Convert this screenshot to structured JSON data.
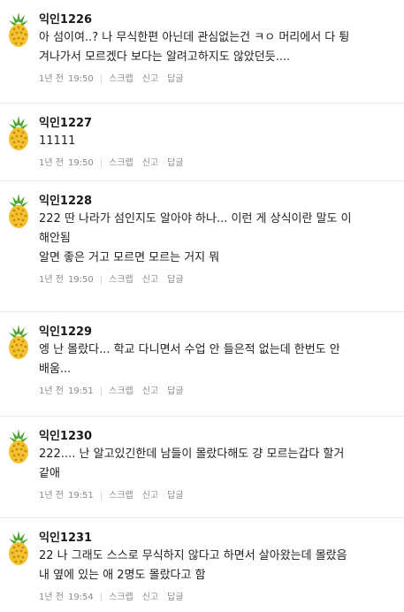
{
  "comments": [
    {
      "nick": "익인1226",
      "lines": [
        "아 섬이여..? 나 무식한편 아닌데 관심없는건 ㅋㅇ 머리에서 다 튕",
        "겨나가서 모르겠다 보다는 알려고하지도 않았던듯...."
      ],
      "date": "1년 전",
      "time": "19:50",
      "actions": {
        "scrap": "스크랩",
        "report": "신고",
        "reply": "답글"
      }
    },
    {
      "nick": "익인1227",
      "lines": [
        "11111"
      ],
      "date": "1년 전",
      "time": "19:50",
      "actions": {
        "scrap": "스크랩",
        "report": "신고",
        "reply": "답글"
      }
    },
    {
      "nick": "익인1228",
      "lines": [
        "222 딴 나라가 섬인지도 알아야 하나... 이런 게 상식이란 말도 이",
        "해안됨",
        "알면 좋은 거고 모르면 모르는 거지 뭐"
      ],
      "date": "1년 전",
      "time": "19:50",
      "actions": {
        "scrap": "스크랩",
        "report": "신고",
        "reply": "답글"
      }
    },
    {
      "nick": "익인1229",
      "lines": [
        "엥 난 몰랐다... 학교 다니면서 수업 안 들은적 없는데 한번도 안",
        "배움..."
      ],
      "date": "1년 전",
      "time": "19:51",
      "actions": {
        "scrap": "스크랩",
        "report": "신고",
        "reply": "답글"
      }
    },
    {
      "nick": "익인1230",
      "lines": [
        "222.... 난 알고있긴한데 남들이 몰랐다해도 걍 모르는갑다 할거",
        "같애"
      ],
      "date": "1년 전",
      "time": "19:51",
      "actions": {
        "scrap": "스크랩",
        "report": "신고",
        "reply": "답글"
      }
    },
    {
      "nick": "익인1231",
      "lines": [
        "22 나 그래도 스스로 무식하지 않다고 하면서 살아왔는데 몰랐음",
        "내 옆에 있는 애 2명도 몰랐다고 함"
      ],
      "date": "1년 전",
      "time": "19:54",
      "actions": {
        "scrap": "스크랩",
        "report": "신고",
        "reply": "답글"
      }
    }
  ],
  "colors": {
    "pineapple_body": "#f2c230",
    "pineapple_leaf": "#4aa52e",
    "meta_text": "#8a8a8a"
  },
  "icons": {
    "avatar": "pineapple-icon"
  }
}
